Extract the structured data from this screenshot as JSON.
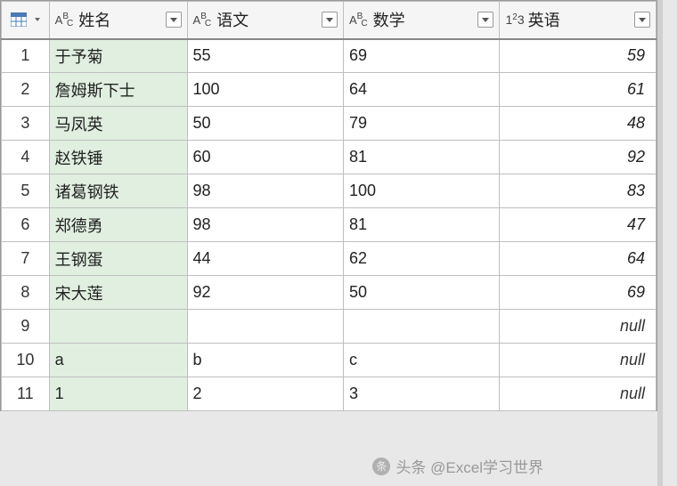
{
  "columns": [
    {
      "name": "姓名",
      "type": "text"
    },
    {
      "name": "语文",
      "type": "text"
    },
    {
      "name": "数学",
      "type": "text"
    },
    {
      "name": "英语",
      "type": "number"
    }
  ],
  "type_labels": {
    "text": "ABC",
    "number": "123"
  },
  "rows": [
    {
      "n": "1",
      "name": "于予菊",
      "c2": "55",
      "c3": "69",
      "c4": "59"
    },
    {
      "n": "2",
      "name": "詹姆斯下士",
      "c2": "100",
      "c3": "64",
      "c4": "61"
    },
    {
      "n": "3",
      "name": "马凤英",
      "c2": "50",
      "c3": "79",
      "c4": "48"
    },
    {
      "n": "4",
      "name": "赵铁锤",
      "c2": "60",
      "c3": "81",
      "c4": "92"
    },
    {
      "n": "5",
      "name": "诸葛钢铁",
      "c2": "98",
      "c3": "100",
      "c4": "83"
    },
    {
      "n": "6",
      "name": "郑德勇",
      "c2": "98",
      "c3": "81",
      "c4": "47"
    },
    {
      "n": "7",
      "name": "王钢蛋",
      "c2": "44",
      "c3": "62",
      "c4": "64"
    },
    {
      "n": "8",
      "name": "宋大莲",
      "c2": "92",
      "c3": "50",
      "c4": "69"
    },
    {
      "n": "9",
      "name": "",
      "c2": "",
      "c3": "",
      "c4": "null"
    },
    {
      "n": "10",
      "name": "a",
      "c2": "b",
      "c3": "c",
      "c4": "null"
    },
    {
      "n": "11",
      "name": "1",
      "c2": "2",
      "c3": "3",
      "c4": "null"
    }
  ],
  "null_text": "null",
  "watermark": "头条 @Excel学习世界",
  "chart_data": {
    "type": "table",
    "columns": [
      "姓名",
      "语文",
      "数学",
      "英语"
    ],
    "rows": [
      [
        "于予菊",
        "55",
        "69",
        59
      ],
      [
        "詹姆斯下士",
        "100",
        "64",
        61
      ],
      [
        "马凤英",
        "50",
        "79",
        48
      ],
      [
        "赵铁锤",
        "60",
        "81",
        92
      ],
      [
        "诸葛钢铁",
        "98",
        "100",
        83
      ],
      [
        "郑德勇",
        "98",
        "81",
        47
      ],
      [
        "王钢蛋",
        "44",
        "62",
        64
      ],
      [
        "宋大莲",
        "92",
        "50",
        69
      ],
      [
        "",
        "",
        "",
        null
      ],
      [
        "a",
        "b",
        "c",
        null
      ],
      [
        "1",
        "2",
        "3",
        null
      ]
    ]
  }
}
